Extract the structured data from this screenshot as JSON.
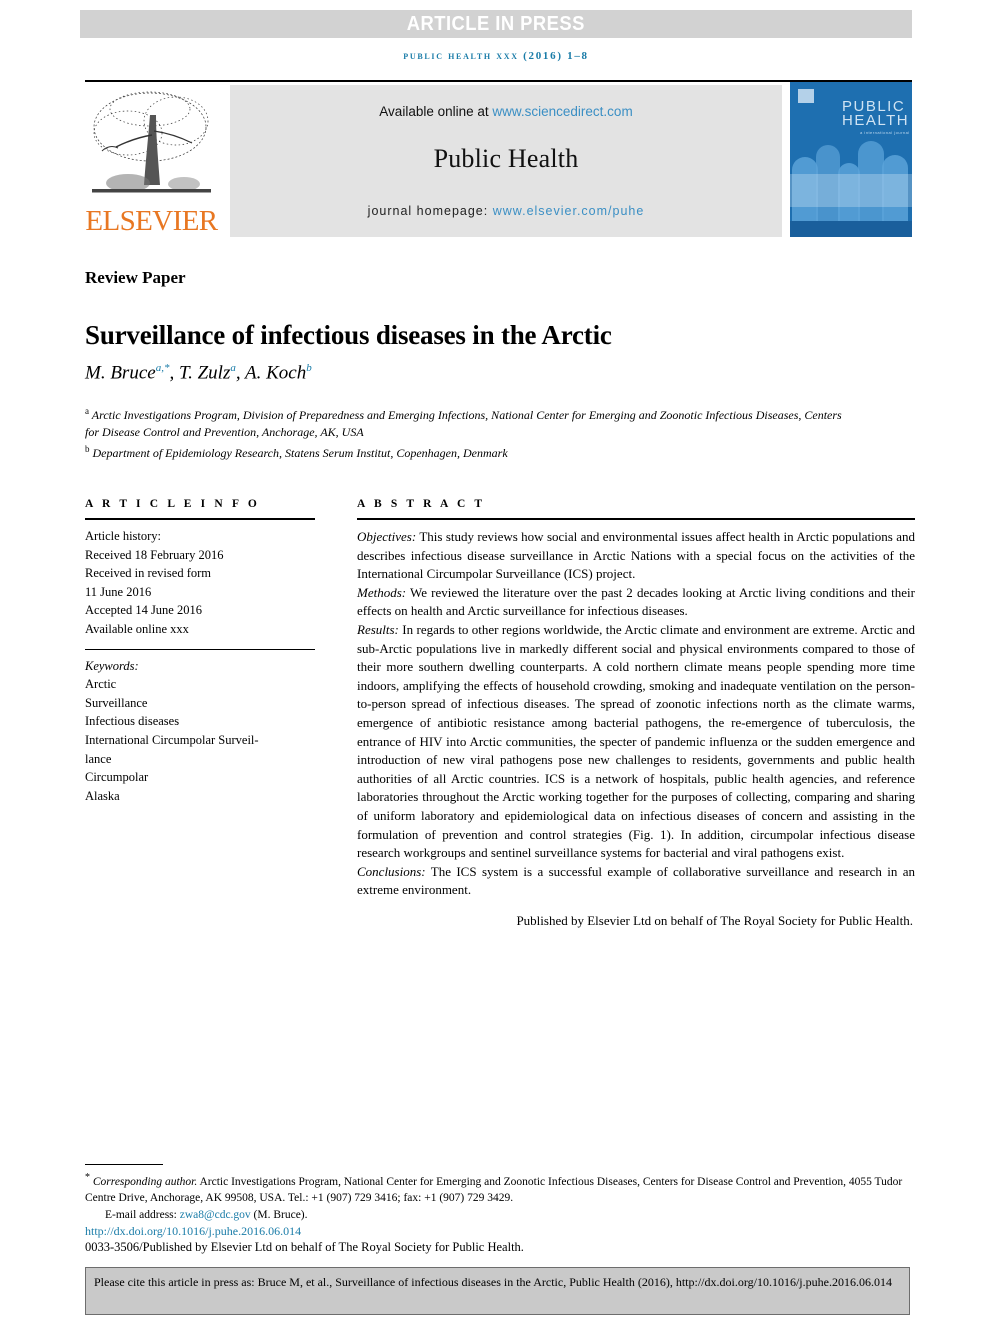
{
  "banner": {
    "text": "ARTICLE IN PRESS"
  },
  "running_head": {
    "text": "public health xxx (2016) 1–8",
    "color": "#1a7ca8"
  },
  "masthead": {
    "available_prefix": "Available online at ",
    "sciencedirect": "www.sciencedirect.com",
    "journal_title": "Public Health",
    "homepage_prefix": "journal homepage: ",
    "homepage_url": "www.elsevier.com/puhe",
    "publisher_logo_text": "ELSEVIER",
    "publisher_logo_color": "#e87722",
    "cover": {
      "title_line1": "PUBLIC",
      "title_line2": "HEALTH",
      "subtitle": "a international journal"
    }
  },
  "article": {
    "type": "Review Paper",
    "title": "Surveillance of infectious diseases in the Arctic",
    "authors_plain": "M. Bruce a,*, T. Zulz a, A. Koch b",
    "authors": [
      {
        "name": "M. Bruce",
        "sup": "a,*"
      },
      {
        "name": "T. Zulz",
        "sup": "a"
      },
      {
        "name": "A. Koch",
        "sup": "b"
      }
    ],
    "affiliations": [
      {
        "marker": "a",
        "text": "Arctic Investigations Program, Division of Preparedness and Emerging Infections, National Center for Emerging and Zoonotic Infectious Diseases, Centers for Disease Control and Prevention, Anchorage, AK, USA"
      },
      {
        "marker": "b",
        "text": "Department of Epidemiology Research, Statens Serum Institut, Copenhagen, Denmark"
      }
    ]
  },
  "article_info": {
    "heading": "A R T I C L E   I N F O",
    "history_label": "Article history:",
    "history": [
      "Received 18 February 2016",
      "Received in revised form",
      "11 June 2016",
      "Accepted 14 June 2016",
      "Available online xxx"
    ],
    "keywords_label": "Keywords:",
    "keywords": [
      "Arctic",
      "Surveillance",
      "Infectious diseases",
      "International Circumpolar Surveil-",
      "lance",
      "Circumpolar",
      "Alaska"
    ]
  },
  "abstract": {
    "heading": "A B S T R A C T",
    "sections": [
      {
        "label": "Objectives:",
        "text": " This study reviews how social and environmental issues affect health in Arctic populations and describes infectious disease surveillance in Arctic Nations with a special focus on the activities of the International Circumpolar Surveillance (ICS) project."
      },
      {
        "label": "Methods:",
        "text": " We reviewed the literature over the past 2 decades looking at Arctic living conditions and their effects on health and Arctic surveillance for infectious diseases."
      },
      {
        "label": "Results:",
        "text": " In regards to other regions worldwide, the Arctic climate and environment are extreme. Arctic and sub-Arctic populations live in markedly different social and physical environments compared to those of their more southern dwelling counterparts. A cold northern climate means people spending more time indoors, amplifying the effects of household crowding, smoking and inadequate ventilation on the person-to-person spread of infectious diseases. The spread of zoonotic infections north as the climate warms, emergence of antibiotic resistance among bacterial pathogens, the re-emergence of tuberculosis, the entrance of HIV into Arctic communities, the specter of pandemic influenza or the sudden emergence and introduction of new viral pathogens pose new challenges to residents, governments and public health authorities of all Arctic countries. ICS is a network of hospitals, public health agencies, and reference laboratories throughout the Arctic working together for the purposes of collecting, comparing and sharing of uniform laboratory and epidemiological data on infectious diseases of concern and assisting in the formulation of prevention and control strategies (Fig. 1). In addition, circumpolar infectious disease research workgroups and sentinel surveillance systems for bacterial and viral pathogens exist."
      },
      {
        "label": "Conclusions:",
        "text": " The ICS system is a successful example of collaborative surveillance and research in an extreme environment."
      }
    ],
    "closing": "Published by Elsevier Ltd on behalf of The Royal Society for Public Health."
  },
  "footnote": {
    "marker": "*",
    "corresponding_label": "Corresponding author.",
    "address": " Arctic Investigations Program, National Center for Emerging and Zoonotic Infectious Diseases, Centers for Disease Control and Prevention, 4055 Tudor Centre Drive, Anchorage, AK 99508, USA. Tel.: +1 (907) 729 3416; fax: +1 (907) 729 3429.",
    "email_label": "E-mail address: ",
    "email": "zwa8@cdc.gov",
    "email_suffix": " (M. Bruce).",
    "doi": "http://dx.doi.org/10.1016/j.puhe.2016.06.014",
    "issn_line": "0033-3506/Published by Elsevier Ltd on behalf of The Royal Society for Public Health."
  },
  "citation_box": {
    "text": "Please cite this article in press as: Bruce M, et al., Surveillance of infectious diseases in the Arctic, Public Health (2016), http://dx.doi.org/10.1016/j.puhe.2016.06.014"
  }
}
